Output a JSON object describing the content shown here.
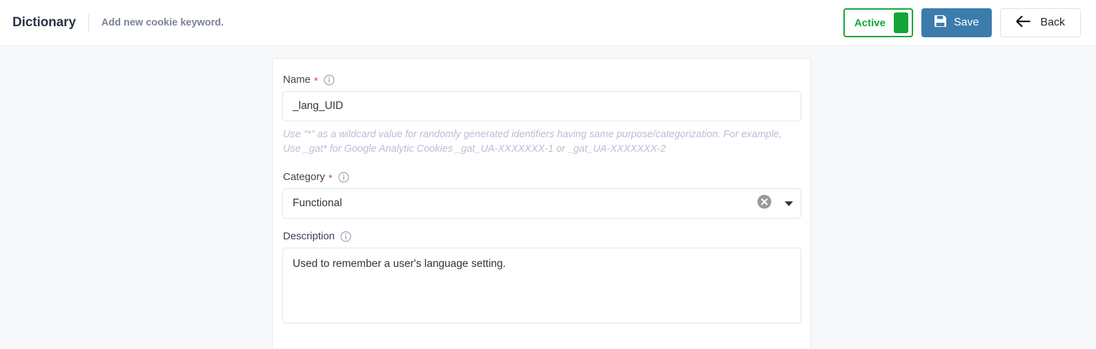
{
  "header": {
    "title": "Dictionary",
    "subtitle": "Add new cookie keyword.",
    "status_toggle": {
      "label": "Active",
      "state": "on",
      "color": "#13a538"
    },
    "save_button": {
      "label": "Save",
      "icon": "floppy-disk-icon",
      "color": "#3b7cad"
    },
    "back_button": {
      "label": "Back",
      "icon": "arrow-left-icon"
    }
  },
  "form": {
    "name_field": {
      "label": "Name",
      "required_marker": "*",
      "info_icon": "info-circle-icon",
      "value": "_lang_UID",
      "placeholder": "",
      "help_text": "Use \"*\" as a wildcard value for randomly generated identifiers having same purpose/categorization. For example, Use _gat* for Google Analytic Cookies _gat_UA-XXXXXXX-1 or _gat_UA-XXXXXXX-2"
    },
    "category_field": {
      "label": "Category",
      "required_marker": "*",
      "info_icon": "info-circle-icon",
      "value": "Functional",
      "clear_icon": "clear-circle-x-icon",
      "dropdown_icon": "chevron-down-icon"
    },
    "description_field": {
      "label": "Description",
      "info_icon": "info-circle-icon",
      "value": "Used to remember a user's language setting.",
      "placeholder": ""
    }
  }
}
